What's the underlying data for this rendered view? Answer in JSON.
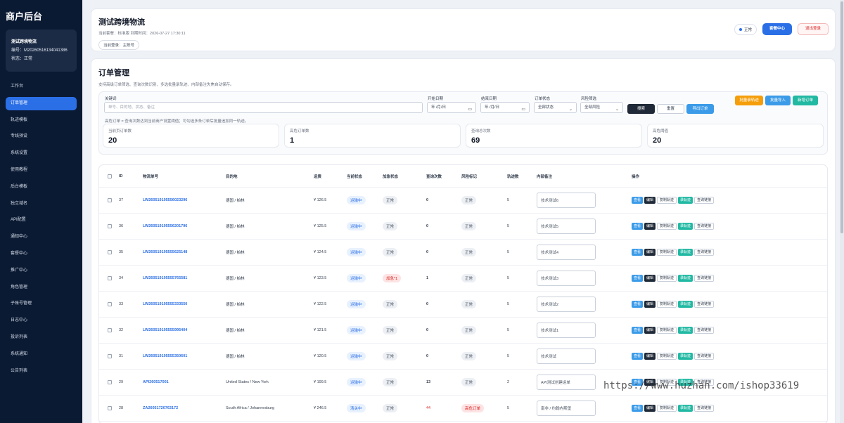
{
  "sidebar": {
    "brand": "商户后台",
    "merchant": {
      "name": "测试跨境物流",
      "id_line": "编号：M20260516134041386",
      "status_line": "状态：正常"
    },
    "items": [
      {
        "label": "工作台"
      },
      {
        "label": "订单管理"
      },
      {
        "label": "轨迹模板"
      },
      {
        "label": "专线预设"
      },
      {
        "label": "系统设置"
      },
      {
        "label": "使用教程"
      },
      {
        "label": "后台模板"
      },
      {
        "label": "独立域名"
      },
      {
        "label": "API配置"
      },
      {
        "label": "通知中心"
      },
      {
        "label": "套餐中心"
      },
      {
        "label": "推广中心"
      },
      {
        "label": "角色管理"
      },
      {
        "label": "子账号管理"
      },
      {
        "label": "日志中心"
      },
      {
        "label": "投诉列表"
      },
      {
        "label": "系统通知"
      },
      {
        "label": "公告列表"
      }
    ]
  },
  "header": {
    "title": "测试跨境物流",
    "meta": "当前套餐：标准版    到期时间：2026-07-27 17:30:11",
    "role": "当前登录：主账号",
    "status": "正常",
    "plan_button": "套餐中心",
    "logout_button": "退出登录"
  },
  "orders": {
    "title": "订单管理",
    "desc": "支持高级订单筛选、查询次数识别、多选批量录轨迹、内部备注失焦自动保存。",
    "filters": {
      "keyword_label": "关键词",
      "keyword_placeholder": "单号、目的地、状态、备注",
      "start_label": "开始日期",
      "end_label": "结束日期",
      "date_placeholder": "年 /月/日",
      "status_label": "订单状态",
      "status_value": "全部状态",
      "risk_label": "风险筛选",
      "risk_value": "全部风险",
      "search_button": "搜索",
      "reset_button": "重置",
      "export_button": "导出订单",
      "batch_track_button": "批量录轨迹",
      "batch_import_button": "批量导入",
      "new_order_button": "新增订单",
      "hint": "高危订单 = 查询次数达到当前商户设置阈值；可勾选多条订单后批量追加同一轨迹。"
    },
    "stats": [
      {
        "label": "当前页订单数",
        "value": "20"
      },
      {
        "label": "高危订单数",
        "value": "1"
      },
      {
        "label": "查询总次数",
        "value": "69"
      },
      {
        "label": "高危阈值",
        "value": "20"
      }
    ],
    "columns": [
      "ID",
      "物流单号",
      "目的地",
      "运费",
      "当前状态",
      "加急状态",
      "查询次数",
      "风险标记",
      "轨迹数",
      "内部备注",
      "操作"
    ],
    "op_labels": {
      "view": "查看",
      "edit": "编辑",
      "copy": "复制轨迹",
      "track": "录轨迹",
      "query": "查询链接"
    },
    "rows": [
      {
        "id": "37",
        "no": "LW260519195556023296",
        "dest": "德国 / 柏林",
        "fee": "¥ 126.5",
        "status": "运输中",
        "urgent": "正常",
        "queries": "0",
        "risk": "正常",
        "tracks": "5",
        "note": "技术测试6"
      },
      {
        "id": "36",
        "no": "LW260519195556201796",
        "dest": "德国 / 柏林",
        "fee": "¥ 125.5",
        "status": "运输中",
        "urgent": "正常",
        "queries": "0",
        "risk": "正常",
        "tracks": "5",
        "note": "技术测试5"
      },
      {
        "id": "35",
        "no": "LW260519195555625148",
        "dest": "德国 / 柏林",
        "fee": "¥ 124.5",
        "status": "运输中",
        "urgent": "正常",
        "queries": "0",
        "risk": "正常",
        "tracks": "5",
        "note": "技术测试4"
      },
      {
        "id": "34",
        "no": "LW260519195555765581",
        "dest": "德国 / 柏林",
        "fee": "¥ 123.5",
        "status": "运输中",
        "urgent": "加急*1",
        "queries": "1",
        "risk": "正常",
        "tracks": "5",
        "note": "技术测试3"
      },
      {
        "id": "33",
        "no": "LW260519195555333550",
        "dest": "德国 / 柏林",
        "fee": "¥ 122.5",
        "status": "运输中",
        "urgent": "正常",
        "queries": "0",
        "risk": "正常",
        "tracks": "5",
        "note": "技术测试2"
      },
      {
        "id": "32",
        "no": "LW260519195555995404",
        "dest": "德国 / 柏林",
        "fee": "¥ 121.5",
        "status": "运输中",
        "urgent": "正常",
        "queries": "0",
        "risk": "正常",
        "tracks": "5",
        "note": "技术测试1"
      },
      {
        "id": "31",
        "no": "LW260519195555350601",
        "dest": "德国 / 柏林",
        "fee": "¥ 120.5",
        "status": "运输中",
        "urgent": "正常",
        "queries": "0",
        "risk": "正常",
        "tracks": "5",
        "note": "技术测试"
      },
      {
        "id": "29",
        "no": "API260517001",
        "dest": "United States / New York",
        "fee": "¥ 199.5",
        "status": "运输中",
        "urgent": "正常",
        "queries": "13",
        "risk": "正常",
        "tracks": "2",
        "note": "API测试创建运单"
      },
      {
        "id": "28",
        "no": "ZA26051720763172",
        "dest": "South Africa / Johannesburg",
        "fee": "¥ 246.5",
        "status": "清关中",
        "urgent": "正常",
        "queries": "44",
        "risk": "高危订单",
        "tracks": "5",
        "note": "南非 / 约翰内斯堡"
      }
    ]
  },
  "watermark": "https://www.huzhan.com/ishop33619"
}
